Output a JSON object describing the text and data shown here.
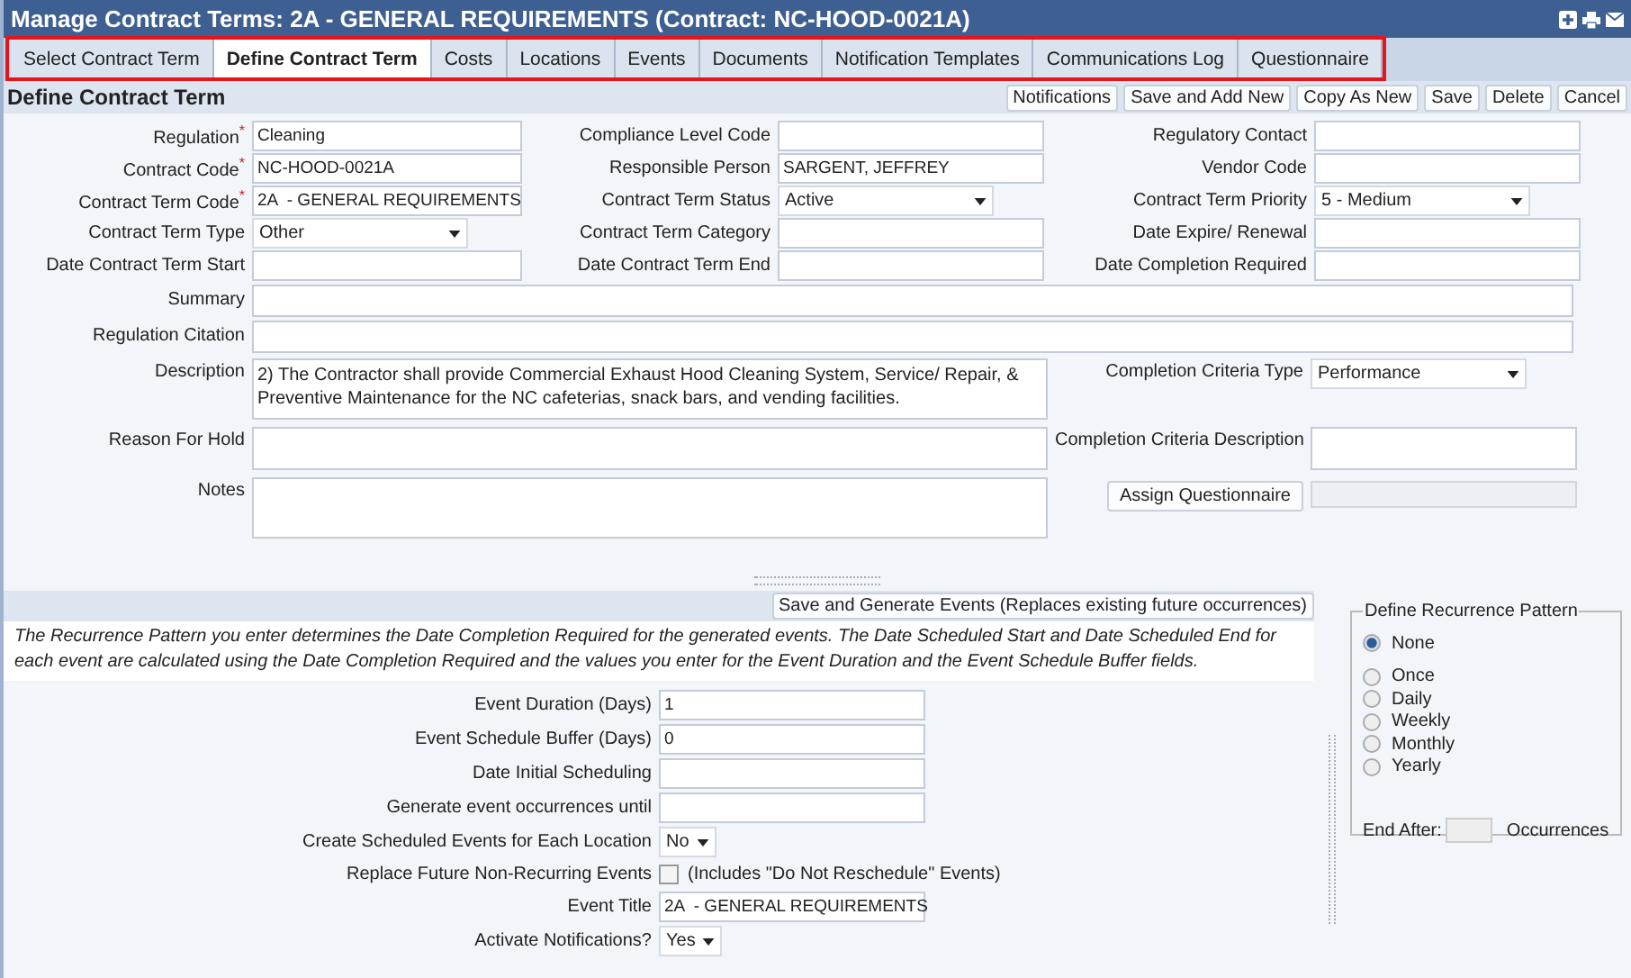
{
  "window": {
    "title": "Manage Contract Terms: 2A - GENERAL REQUIREMENTS (Contract: NC-HOOD-0021A)"
  },
  "tabs": [
    {
      "label": "Select Contract Term",
      "selected": false
    },
    {
      "label": "Define Contract Term",
      "selected": true
    },
    {
      "label": "Costs",
      "selected": false
    },
    {
      "label": "Locations",
      "selected": false
    },
    {
      "label": "Events",
      "selected": false
    },
    {
      "label": "Documents",
      "selected": false
    },
    {
      "label": "Notification Templates",
      "selected": false
    },
    {
      "label": "Communications Log",
      "selected": false
    },
    {
      "label": "Questionnaire",
      "selected": false
    }
  ],
  "section_title": "Define Contract Term",
  "toolbar_buttons": [
    "Notifications",
    "Save and Add New",
    "Copy As New",
    "Save",
    "Delete",
    "Cancel"
  ],
  "form_rows": [
    [
      {
        "label": "Regulation",
        "required_mark": "*",
        "kind": "text",
        "value": "Cleaning"
      },
      {
        "label": "Compliance Level Code",
        "kind": "text"
      },
      {
        "label": "Regulatory Contact",
        "kind": "text"
      }
    ],
    [
      {
        "label": "Contract Code",
        "required_mark": "*",
        "kind": "text",
        "value": "NC-HOOD-0021A"
      },
      {
        "label": "Responsible Person",
        "kind": "text",
        "value": "SARGENT, JEFFREY"
      },
      {
        "label": "Vendor Code",
        "kind": "text"
      }
    ],
    [
      {
        "label": "Contract Term Code",
        "required_mark": "*",
        "kind": "text",
        "value": "2A  - GENERAL REQUIREMENTS"
      },
      {
        "label": "Contract Term Status",
        "kind": "select",
        "value": "Active"
      },
      {
        "label": "Contract Term Priority",
        "kind": "select",
        "value": "5 - Medium"
      }
    ],
    [
      {
        "label": "Contract Term Type",
        "kind": "select",
        "value": "Other"
      },
      {
        "label": "Contract Term Category",
        "kind": "text"
      },
      {
        "label": "Date Expire/ Renewal",
        "kind": "text"
      }
    ],
    [
      {
        "label": "Date Contract Term Start",
        "kind": "text"
      },
      {
        "label": "Date Contract Term End",
        "kind": "text"
      },
      {
        "label": "Date Completion Required",
        "kind": "text"
      }
    ]
  ],
  "wide_fields": [
    {
      "label": "Summary"
    },
    {
      "label": "Regulation Citation"
    }
  ],
  "description": {
    "label": "Description",
    "value": "2)     The Contractor shall provide Commercial Exhaust Hood Cleaning System, Service/ Repair, & Preventive Maintenance for the NC cafeterias, snack bars, and vending facilities."
  },
  "completion_criteria_type": {
    "label": "Completion Criteria Type",
    "value": "Performance"
  },
  "reason_for_hold": {
    "label": "Reason For Hold"
  },
  "completion_criteria_description": {
    "label": "Completion Criteria Description"
  },
  "notes": {
    "label": "Notes"
  },
  "assign_questionnaire_button": "Assign Questionnaire",
  "generate_button": "Save and Generate Events (Replaces existing future occurrences)",
  "recurrence_note": "The Recurrence Pattern you enter determines the Date Completion Required for the generated events. The Date Scheduled Start and Date Scheduled End for each event are calculated using the Date Completion Required and the values you enter for the Event Duration and the Event Schedule Buffer fields.",
  "event_fields": [
    {
      "label": "Event Duration (Days)",
      "kind": "text",
      "value": "1"
    },
    {
      "label": "Event Schedule Buffer (Days)",
      "kind": "text",
      "value": "0"
    },
    {
      "label": "Date Initial Scheduling",
      "kind": "text"
    },
    {
      "label": "Generate event occurrences until",
      "kind": "text"
    },
    {
      "label": "Create Scheduled Events for Each Location",
      "kind": "select",
      "value": "No"
    },
    {
      "label": "Replace Future Non-Recurring Events",
      "kind": "checkbox",
      "checked": false,
      "note": "(Includes \"Do Not Reschedule\" Events)"
    },
    {
      "label": "Event Title",
      "kind": "text",
      "value": "2A  - GENERAL REQUIREMENTS"
    },
    {
      "label": "Activate Notifications?",
      "kind": "select",
      "value": "Yes"
    }
  ],
  "recurrence": {
    "title": "Define Recurrence Pattern",
    "options": [
      {
        "label": "None",
        "selected": true
      },
      {
        "label": "Once",
        "selected": false
      },
      {
        "label": "Daily",
        "selected": false
      },
      {
        "label": "Weekly",
        "selected": false
      },
      {
        "label": "Monthly",
        "selected": false
      },
      {
        "label": "Yearly",
        "selected": false
      }
    ],
    "end_after_label": "End After:",
    "occurrences_label": "Occurrences"
  }
}
